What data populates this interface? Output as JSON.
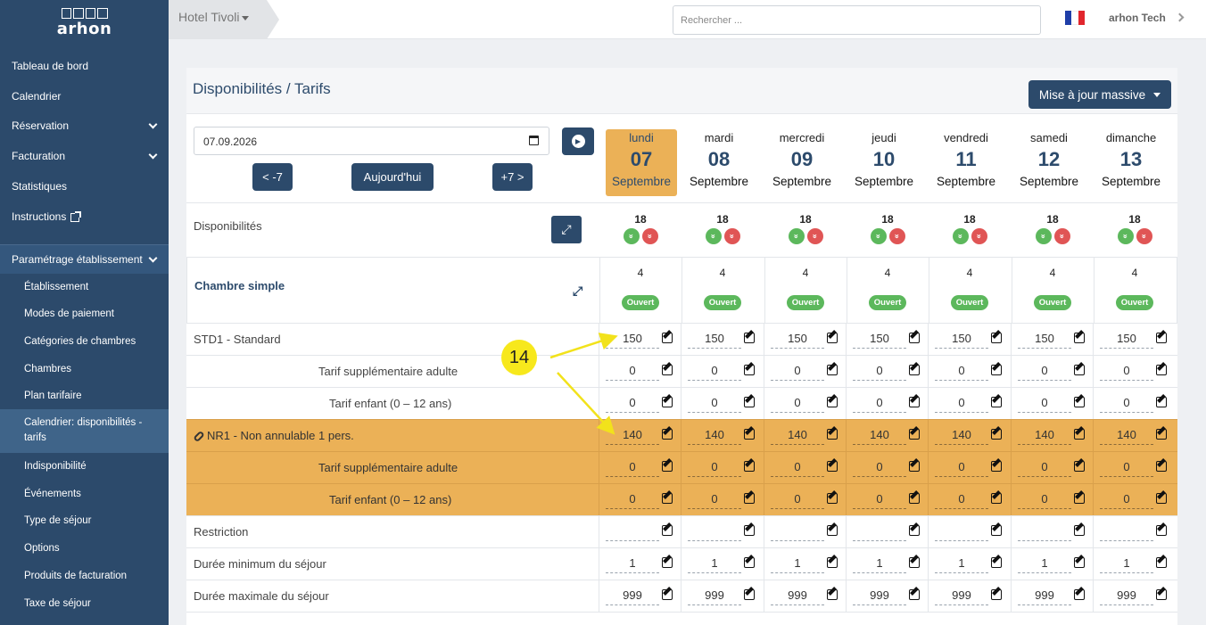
{
  "sidebar": {
    "logo": "arhon",
    "items": [
      {
        "label": "Tableau de bord"
      },
      {
        "label": "Calendrier"
      },
      {
        "label": "Réservation"
      },
      {
        "label": "Facturation"
      },
      {
        "label": "Statistiques"
      },
      {
        "label": "Instructions"
      },
      {
        "label": "Paramétrage établissement"
      }
    ],
    "subitems": [
      {
        "label": "Établissement"
      },
      {
        "label": "Modes de paiement"
      },
      {
        "label": "Catégories de chambres"
      },
      {
        "label": "Chambres"
      },
      {
        "label": "Plan tarifaire"
      },
      {
        "label": "Calendrier: disponibilités - tarifs"
      },
      {
        "label": "Indisponibilité"
      },
      {
        "label": "Événements"
      },
      {
        "label": "Type de séjour"
      },
      {
        "label": "Options"
      },
      {
        "label": "Produits de facturation"
      },
      {
        "label": "Taxe de séjour"
      }
    ]
  },
  "topbar": {
    "hotel": "Hotel Tivoli",
    "search_placeholder": "Rechercher ...",
    "user": "arhon Tech",
    "flag_colors": [
      "#1f3ea8",
      "#ffffff",
      "#e1262d"
    ]
  },
  "header": {
    "title": "Disponibilités / Tarifs",
    "mass_update": "Mise à jour massive"
  },
  "controls": {
    "date": "07.09.2026",
    "prev": "< -7",
    "today": "Aujourd'hui",
    "next": "+7 >"
  },
  "days": [
    {
      "name": "lundi",
      "num": "07",
      "month": "Septembre"
    },
    {
      "name": "mardi",
      "num": "08",
      "month": "Septembre"
    },
    {
      "name": "mercredi",
      "num": "09",
      "month": "Septembre"
    },
    {
      "name": "jeudi",
      "num": "10",
      "month": "Septembre"
    },
    {
      "name": "vendredi",
      "num": "11",
      "month": "Septembre"
    },
    {
      "name": "samedi",
      "num": "12",
      "month": "Septembre"
    },
    {
      "name": "dimanche",
      "num": "13",
      "month": "Septembre"
    }
  ],
  "availability": {
    "label": "Disponibilités",
    "values": [
      "18",
      "18",
      "18",
      "18",
      "18",
      "18",
      "18"
    ]
  },
  "room": {
    "name": "Chambre simple",
    "counts": [
      "4",
      "4",
      "4",
      "4",
      "4",
      "4",
      "4"
    ],
    "status": "Ouvert"
  },
  "rows": [
    {
      "label": "STD1 - Standard",
      "values": [
        "150",
        "150",
        "150",
        "150",
        "150",
        "150",
        "150"
      ]
    },
    {
      "label": "Tarif supplémentaire adulte",
      "values": [
        "0",
        "0",
        "0",
        "0",
        "0",
        "0",
        "0"
      ]
    },
    {
      "label": "Tarif enfant (0 – 12 ans)",
      "values": [
        "0",
        "0",
        "0",
        "0",
        "0",
        "0",
        "0"
      ]
    },
    {
      "label": "NR1 - Non annulable 1 pers.",
      "values": [
        "140",
        "140",
        "140",
        "140",
        "140",
        "140",
        "140"
      ]
    },
    {
      "label": "Tarif supplémentaire adulte",
      "values": [
        "0",
        "0",
        "0",
        "0",
        "0",
        "0",
        "0"
      ]
    },
    {
      "label": "Tarif enfant (0 – 12 ans)",
      "values": [
        "0",
        "0",
        "0",
        "0",
        "0",
        "0",
        "0"
      ]
    },
    {
      "label": "Restriction",
      "values": [
        "",
        "",
        "",
        "",
        "",
        "",
        ""
      ]
    },
    {
      "label": "Durée minimum du séjour",
      "values": [
        "1",
        "1",
        "1",
        "1",
        "1",
        "1",
        "1"
      ]
    },
    {
      "label": "Durée maximale du séjour",
      "values": [
        "999",
        "999",
        "999",
        "999",
        "999",
        "999",
        "999"
      ]
    }
  ],
  "annotation": {
    "number": "14"
  },
  "colors": {
    "sidebar": "#2c4a6b",
    "accent": "#ebb157",
    "open": "#5cb85c",
    "closed": "#e05555"
  }
}
